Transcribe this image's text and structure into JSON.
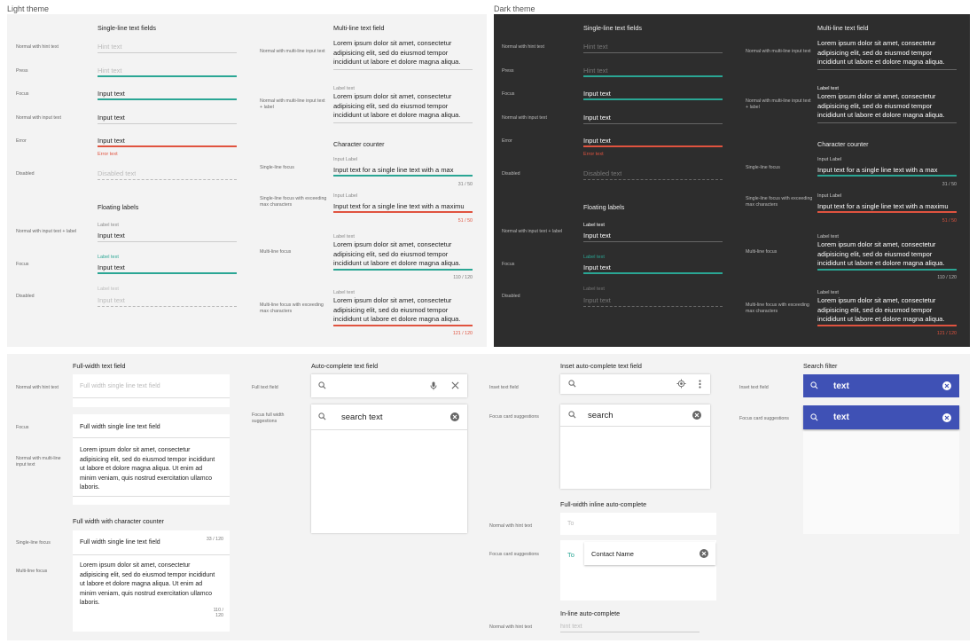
{
  "light": {
    "title": "Light theme",
    "single": {
      "heading": "Single-line text fields",
      "rows": [
        {
          "label": "Normal with hint text",
          "value": "Hint text"
        },
        {
          "label": "Press",
          "value": "Hint text"
        },
        {
          "label": "Focus",
          "value": "Input text"
        },
        {
          "label": "Normal with input text",
          "value": "Input text"
        },
        {
          "label": "Error",
          "value": "Input text",
          "error": "Error text"
        },
        {
          "label": "Disabled",
          "value": "Disabled text"
        }
      ]
    },
    "floating": {
      "heading": "Floating labels",
      "rows": [
        {
          "label": "Normal with input text + label",
          "sub": "Label text",
          "value": "Input text"
        },
        {
          "label": "Focus",
          "sub": "Label text",
          "value": "Input text"
        },
        {
          "label": "Disabled",
          "sub": "Label text",
          "value": "Input text"
        }
      ]
    },
    "multi": {
      "heading": "Multi-line text field",
      "rows": [
        {
          "label": "Normal with multi-line input text",
          "lines": [
            "Lorem ipsum dolor sit amet, consectetur",
            "adipisicing elit, sed do eiusmod tempor",
            "incididunt ut labore et dolore magna aliqua."
          ]
        },
        {
          "label": "Normal with multi-line input text + label",
          "sub": "Label text",
          "lines": [
            "Lorem ipsum dolor sit amet, consectetur",
            "adipisicing elit, sed do eiusmod tempor",
            "incididunt ut labore et dolore magna aliqua."
          ]
        }
      ]
    },
    "counter": {
      "heading": "Character counter",
      "rows": [
        {
          "label": "Single-line focus",
          "sub": "Input Label",
          "value": "Input text for a single line text with a max",
          "count": "31 / 50"
        },
        {
          "label": "Single-line focus with exceeding max characters",
          "sub": "Input Label",
          "value": "Input text for a single line text with a maximu",
          "count": "51 / 50"
        },
        {
          "label": "Multi-line focus",
          "sub": "Label text",
          "lines": [
            "Lorem ipsum dolor sit amet, consectetur",
            "adipisicing elit, sed do eiusmod tempor",
            "incididunt ut labore et dolore magna aliqua."
          ],
          "count": "110 / 120"
        },
        {
          "label": "Multi-line focus with exceeding max characters",
          "sub": "Label text",
          "lines": [
            "Lorem ipsum dolor sit amet, consectetur",
            "adipisicing elit, sed do eiusmod tempor",
            "incididunt ut labore et dolore magna aliqua."
          ],
          "count": "121 / 120"
        }
      ]
    }
  },
  "dark": {
    "title": "Dark theme",
    "single": {
      "heading": "Single-line text fields",
      "rows": [
        {
          "label": "Normal with hint text",
          "value": "Hint text"
        },
        {
          "label": "Press",
          "value": "Hint text"
        },
        {
          "label": "Focus",
          "value": "Input text"
        },
        {
          "label": "Normal with input text",
          "value": "Input text"
        },
        {
          "label": "Error",
          "value": "Input text",
          "error": "Error text"
        },
        {
          "label": "Disabled",
          "value": "Disabled text"
        }
      ]
    },
    "floating": {
      "heading": "Floating labels",
      "rows": [
        {
          "label": "Normal with input text + label",
          "sub": "Label text",
          "value": "Input text"
        },
        {
          "label": "Focus",
          "sub": "Label text",
          "value": "Input text"
        },
        {
          "label": "Disabled",
          "sub": "Label text",
          "value": "Input text"
        }
      ]
    },
    "multi": {
      "heading": "Multi-line text field",
      "rows": [
        {
          "label": "Normal with multi-line input text",
          "lines": [
            "Lorem ipsum dolor sit amet, consectetur",
            "adipisicing elit, sed do eiusmod tempor",
            "incididunt ut labore et dolore magna aliqua."
          ]
        },
        {
          "label": "Normal with multi-line input text + label",
          "sub": "Label text",
          "lines": [
            "Lorem ipsum dolor sit amet, consectetur",
            "adipisicing elit, sed do eiusmod tempor",
            "incididunt ut labore et dolore magna aliqua."
          ]
        }
      ]
    },
    "counter": {
      "heading": "Character counter",
      "rows": [
        {
          "label": "Single-line focus",
          "sub": "Input Label",
          "value": "Input text for a single line text with a max",
          "count": "31 / 50"
        },
        {
          "label": "Single-line focus with exceeding max characters",
          "sub": "Input Label",
          "value": "Input text for a single line text with a maximu",
          "count": "51 / 50"
        },
        {
          "label": "Multi-line focus",
          "sub": "Label text",
          "lines": [
            "Lorem ipsum dolor sit amet, consectetur",
            "adipisicing elit, sed do eiusmod tempor",
            "incididunt ut labore et dolore magna aliqua."
          ],
          "count": "110 / 120"
        },
        {
          "label": "Multi-line focus with exceeding max characters",
          "sub": "Label text",
          "lines": [
            "Lorem ipsum dolor sit amet, consectetur",
            "adipisicing elit, sed do eiusmod tempor",
            "incididunt ut labore et dolore magna aliqua."
          ],
          "count": "121 / 120"
        }
      ]
    }
  },
  "fullwidth": {
    "heading": "Full-width text field",
    "hint_label": "Normal with hint text",
    "hint_value": "Full width single line text field",
    "focus_label": "Focus",
    "focus_value": "Full width single line text field",
    "multi_label": "Normal with multi-line input text",
    "multi_lines": [
      "Lorem ipsum dolor sit amet, consectetur",
      "adipisicing elit, sed do eiusmod tempor incididunt",
      "ut labore et dolore magna aliqua. Ut enim ad",
      "minim veniam, quis nostrud exercitation ullamco",
      "laboris."
    ],
    "counter_heading": "Full width with character counter",
    "single_focus_label": "Single-line focus",
    "single_focus_value": "Full width single line text field",
    "single_count": "33 / 120",
    "multi_focus_label": "Multi-line focus",
    "multi_focus_lines": [
      "Lorem ipsum dolor sit amet, consectetur",
      "adipisicing elit, sed do eiusmod tempor incididunt",
      "ut labore et dolore magna aliqua. Ut enim ad",
      "minim veniam, quis nostrud exercitation ullamco",
      "laboris."
    ],
    "multi_count": "110 / 120"
  },
  "autocomplete": {
    "heading": "Auto-complete text field",
    "full_label": "Full text field",
    "focus_label": "Focus full width suggestions",
    "focus_value": "search text"
  },
  "inset": {
    "heading": "Inset auto-complete text field",
    "field_label": "Inset text field",
    "focus_label": "Focus card suggestions",
    "focus_value": "search",
    "inline_heading": "Full-width inline auto-complete",
    "inline_hint_label": "Normal with hint text",
    "inline_hint": "To",
    "inline_focus_label": "Focus card suggestions",
    "inline_to": "To",
    "inline_contact": "Contact Name",
    "inline2_heading": "In-line auto-complete",
    "inline2_label": "Normal with hint text",
    "inline2_hint": "hint text"
  },
  "searchfilter": {
    "heading": "Search filter",
    "field_label": "Inset text field",
    "field_value": "text",
    "focus_label": "Focus card suggestions",
    "focus_value": "text"
  },
  "colors": {
    "teal": "#2aa694",
    "red": "#e0533f",
    "indigo": "#3f51b5",
    "dark_panel": "#2d2d2d",
    "light_panel": "#f3f3f3"
  }
}
